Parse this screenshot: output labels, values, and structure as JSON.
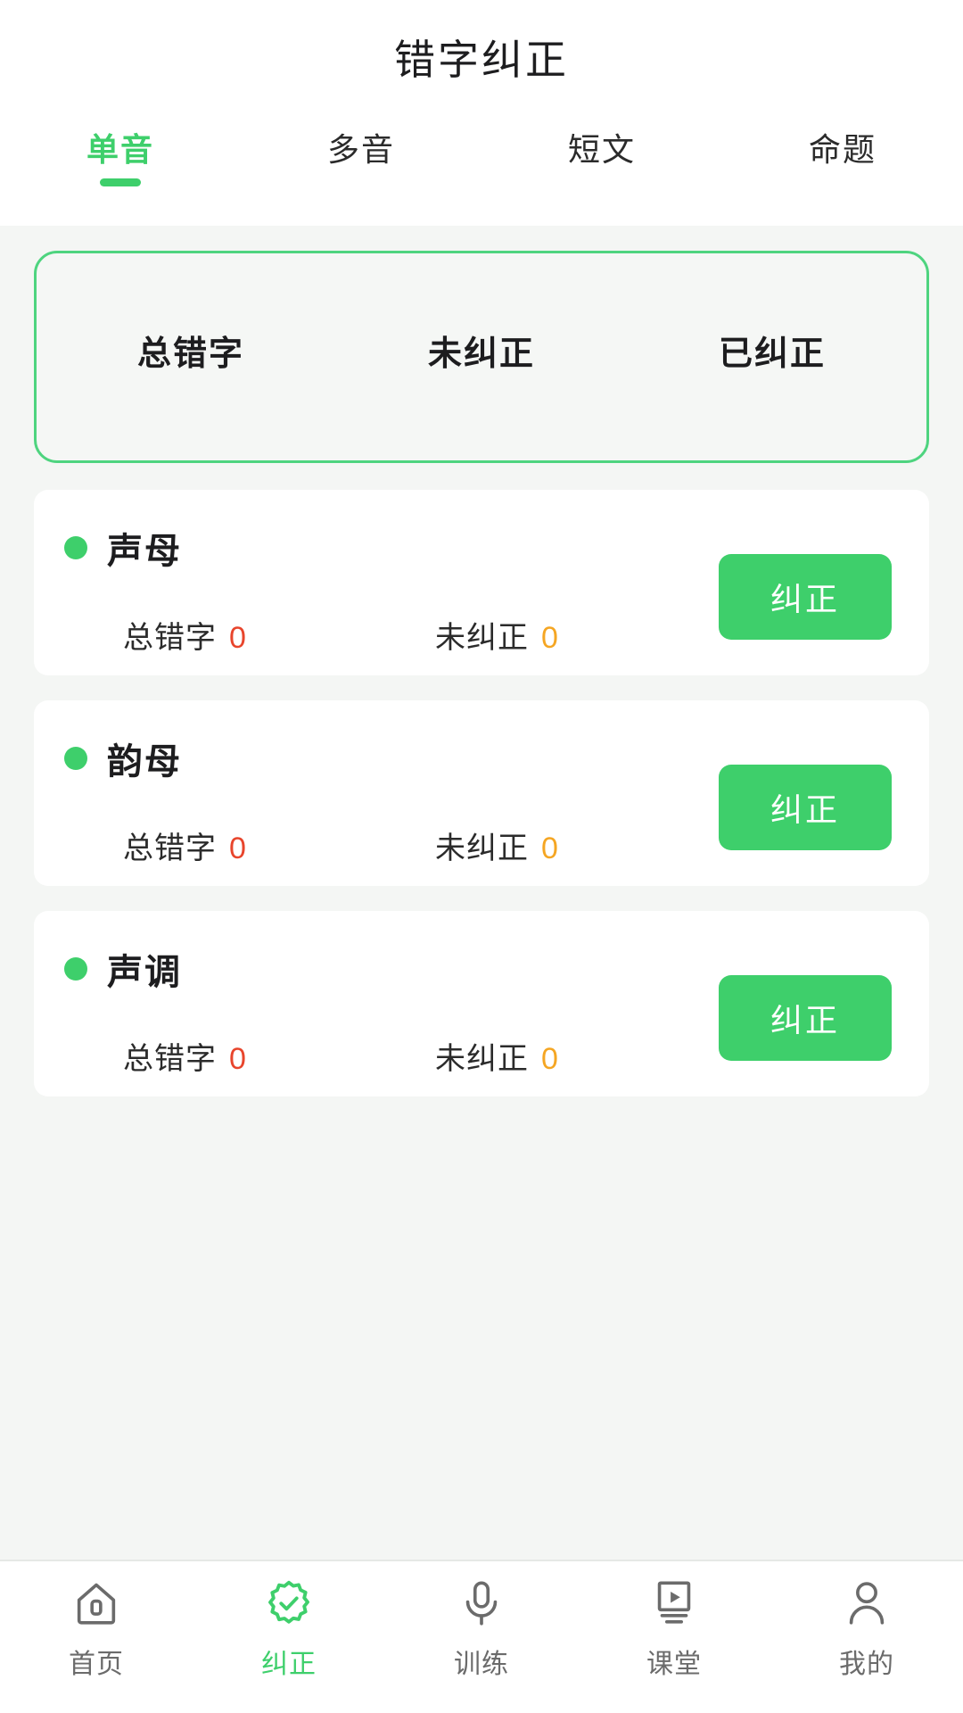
{
  "header": {
    "title": "错字纠正"
  },
  "tabs": [
    {
      "label": "单音",
      "active": true
    },
    {
      "label": "多音",
      "active": false
    },
    {
      "label": "短文",
      "active": false
    },
    {
      "label": "命题",
      "active": false
    }
  ],
  "summary": {
    "columns": [
      {
        "label": "总错字",
        "value": ""
      },
      {
        "label": "未纠正",
        "value": ""
      },
      {
        "label": "已纠正",
        "value": ""
      }
    ]
  },
  "items": [
    {
      "title": "声母",
      "total_label": "总错字",
      "total_value": "0",
      "uncorrected_label": "未纠正",
      "uncorrected_value": "0",
      "button_label": "纠正"
    },
    {
      "title": "韵母",
      "total_label": "总错字",
      "total_value": "0",
      "uncorrected_label": "未纠正",
      "uncorrected_value": "0",
      "button_label": "纠正"
    },
    {
      "title": "声调",
      "total_label": "总错字",
      "total_value": "0",
      "uncorrected_label": "未纠正",
      "uncorrected_value": "0",
      "button_label": "纠正"
    }
  ],
  "bottom_nav": [
    {
      "label": "首页",
      "icon": "home-icon",
      "active": false
    },
    {
      "label": "纠正",
      "icon": "badge-check-icon",
      "active": true
    },
    {
      "label": "训练",
      "icon": "microphone-icon",
      "active": false
    },
    {
      "label": "课堂",
      "icon": "classroom-monitor-icon",
      "active": false
    },
    {
      "label": "我的",
      "icon": "person-icon",
      "active": false
    }
  ],
  "colors": {
    "accent_green": "#3ecf6b",
    "card_border_green": "#4ed47f",
    "error_red": "#e8452c",
    "warn_amber": "#f5a623",
    "page_bg": "#f4f6f4",
    "card_bg": "#ffffff",
    "text_primary": "#1d1d1f",
    "text_muted": "#6b6b6b"
  }
}
